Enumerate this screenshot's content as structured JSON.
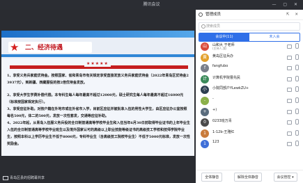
{
  "window": {
    "title": "腾讯会议"
  },
  "share": {
    "label": "青岛区县的招聘幕共享"
  },
  "slide": {
    "title": "二、经济待遇",
    "stars": "★★★★★",
    "paragraphs": [
      "1、享受义务兵家庭优待金。按照国家、省和青岛市有关规定享受直接发放义务兵家庭优待金（2022年青岛区优待金23937元），到新疆、西藏服役的按2倍优待金发放。",
      "2、享受大学生学费补偿代偿。本专科生每人每年最高不超过12000元，硕士研究生每人每年最高不超过16000元（标准按国家规定执行）。",
      "3、享受应征补助。对按户籍在外地市或在外省市入学，目前区应征并被批准入伍的男性大学生，由区应征办公室按照每名500元，体二的500元，发放一次性套发，交通等应征补助。",
      "4、2022年起，从青岛入伍服义务兵役的全日制普通高等学校毕业生和入伍当年6月30日前取得毕业证书的上年毕业生入伍的全日制普通高等学校毕业班生以及境外国家认可的高级以上职业技能等级证书的高级技工学校和技师学院毕业生，按照本科以上学历毕业生不低于8000元，专科毕业生（含高级技工院校毕业生）不低于5000元标准，发放一次性奖励金。"
    ]
  },
  "panel": {
    "title": "管理成员",
    "header_ctrls": "⇱ ✕",
    "search_placeholder": "搜索成员",
    "tabs": [
      {
        "label": "会议中(11)"
      },
      {
        "label": "未入会"
      }
    ],
    "members": [
      {
        "name": "山和大 于老师",
        "sub": "(主持人,我)",
        "avatar": "山",
        "color": "#d94a3a",
        "mic_on": false
      },
      {
        "name": "黄岛区征兵办",
        "sub": "",
        "avatar": "黄",
        "color": "#e3a02b",
        "mic_on": false
      },
      {
        "name": "fangfubo",
        "sub": "",
        "avatar": "f",
        "color": "#7a7f8a",
        "mic_on": false
      },
      {
        "name": "计算机学院曹先民",
        "sub": "",
        "avatar": "计",
        "color": "#3b8a5a",
        "mic_on": false
      },
      {
        "name": "小院同部户YLewkZU+",
        "sub": "",
        "avatar": "小",
        "color": "#2c3e50",
        "mic_on": false
      },
      {
        "name": "-",
        "sub": "",
        "avatar": "-",
        "color": "#8bb04a",
        "mic_on": false
      },
      {
        "name": "+)",
        "sub": "",
        "avatar": "+",
        "color": "#5a6c7d",
        "mic_on": false
      },
      {
        "name": "0233班万青",
        "sub": "",
        "avatar": "0",
        "color": "#4a4a4a",
        "mic_on": false
      },
      {
        "name": "1-12b-王雅红",
        "sub": "",
        "avatar": "1",
        "color": "#c97b3b",
        "mic_on": false
      },
      {
        "name": "123",
        "sub": "",
        "avatar": "1",
        "color": "#3f6fd8",
        "mic_on": false
      }
    ],
    "footer": {
      "mute_all": "全体静音",
      "unmute_all": "解除全体静音",
      "manage": "会议管控 ▾"
    }
  }
}
